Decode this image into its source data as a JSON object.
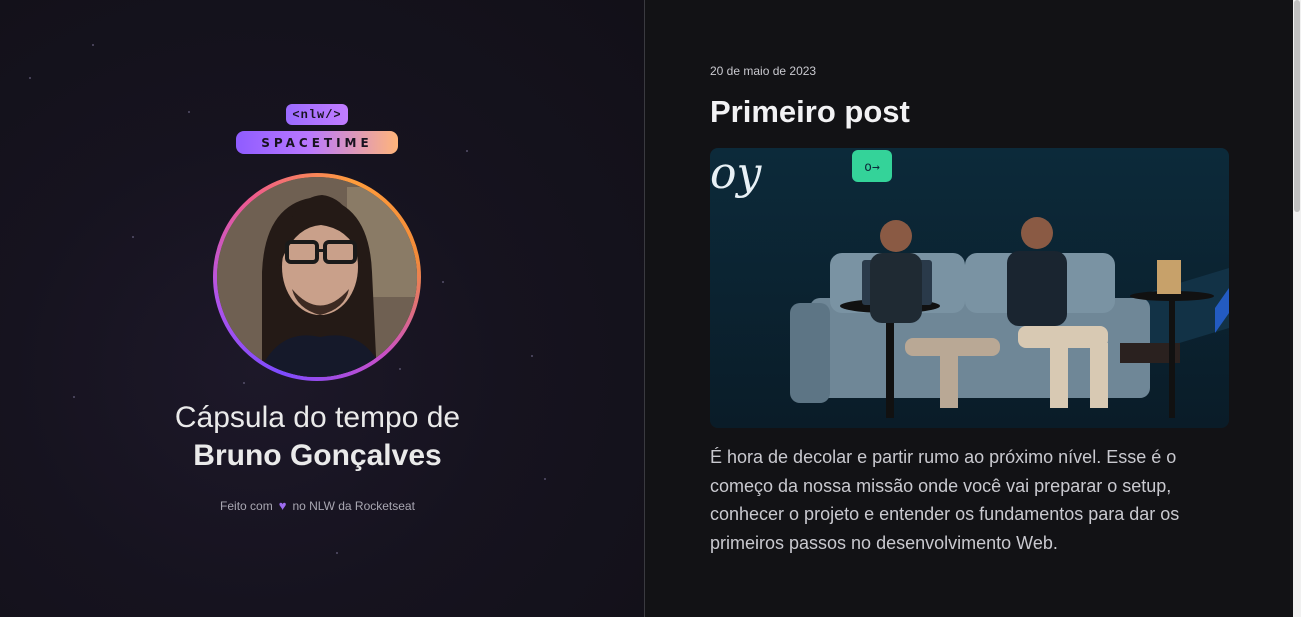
{
  "brand": {
    "logo_tag": "<nlw/>",
    "logo_word": "SPACETIME"
  },
  "profile": {
    "title_line1": "Cápsula do tempo de",
    "name": "Bruno Gonçalves"
  },
  "credits": {
    "before": "Feito com",
    "after": "no NLW da Rocketseat"
  },
  "memory": {
    "date": "20 de maio de 2023",
    "title": "Primeiro post",
    "body": "É hora de decolar e partir rumo ao próximo nível. Esse é o começo da nossa missão onde você vai preparar o setup, conhecer o projeto e entender os fundamentos para dar os primeiros passos no desenvolvimento Web."
  },
  "colors": {
    "brand_purple": "#8f5cff",
    "brand_orange": "#ffb57a",
    "heart": "#9d6cf0"
  }
}
